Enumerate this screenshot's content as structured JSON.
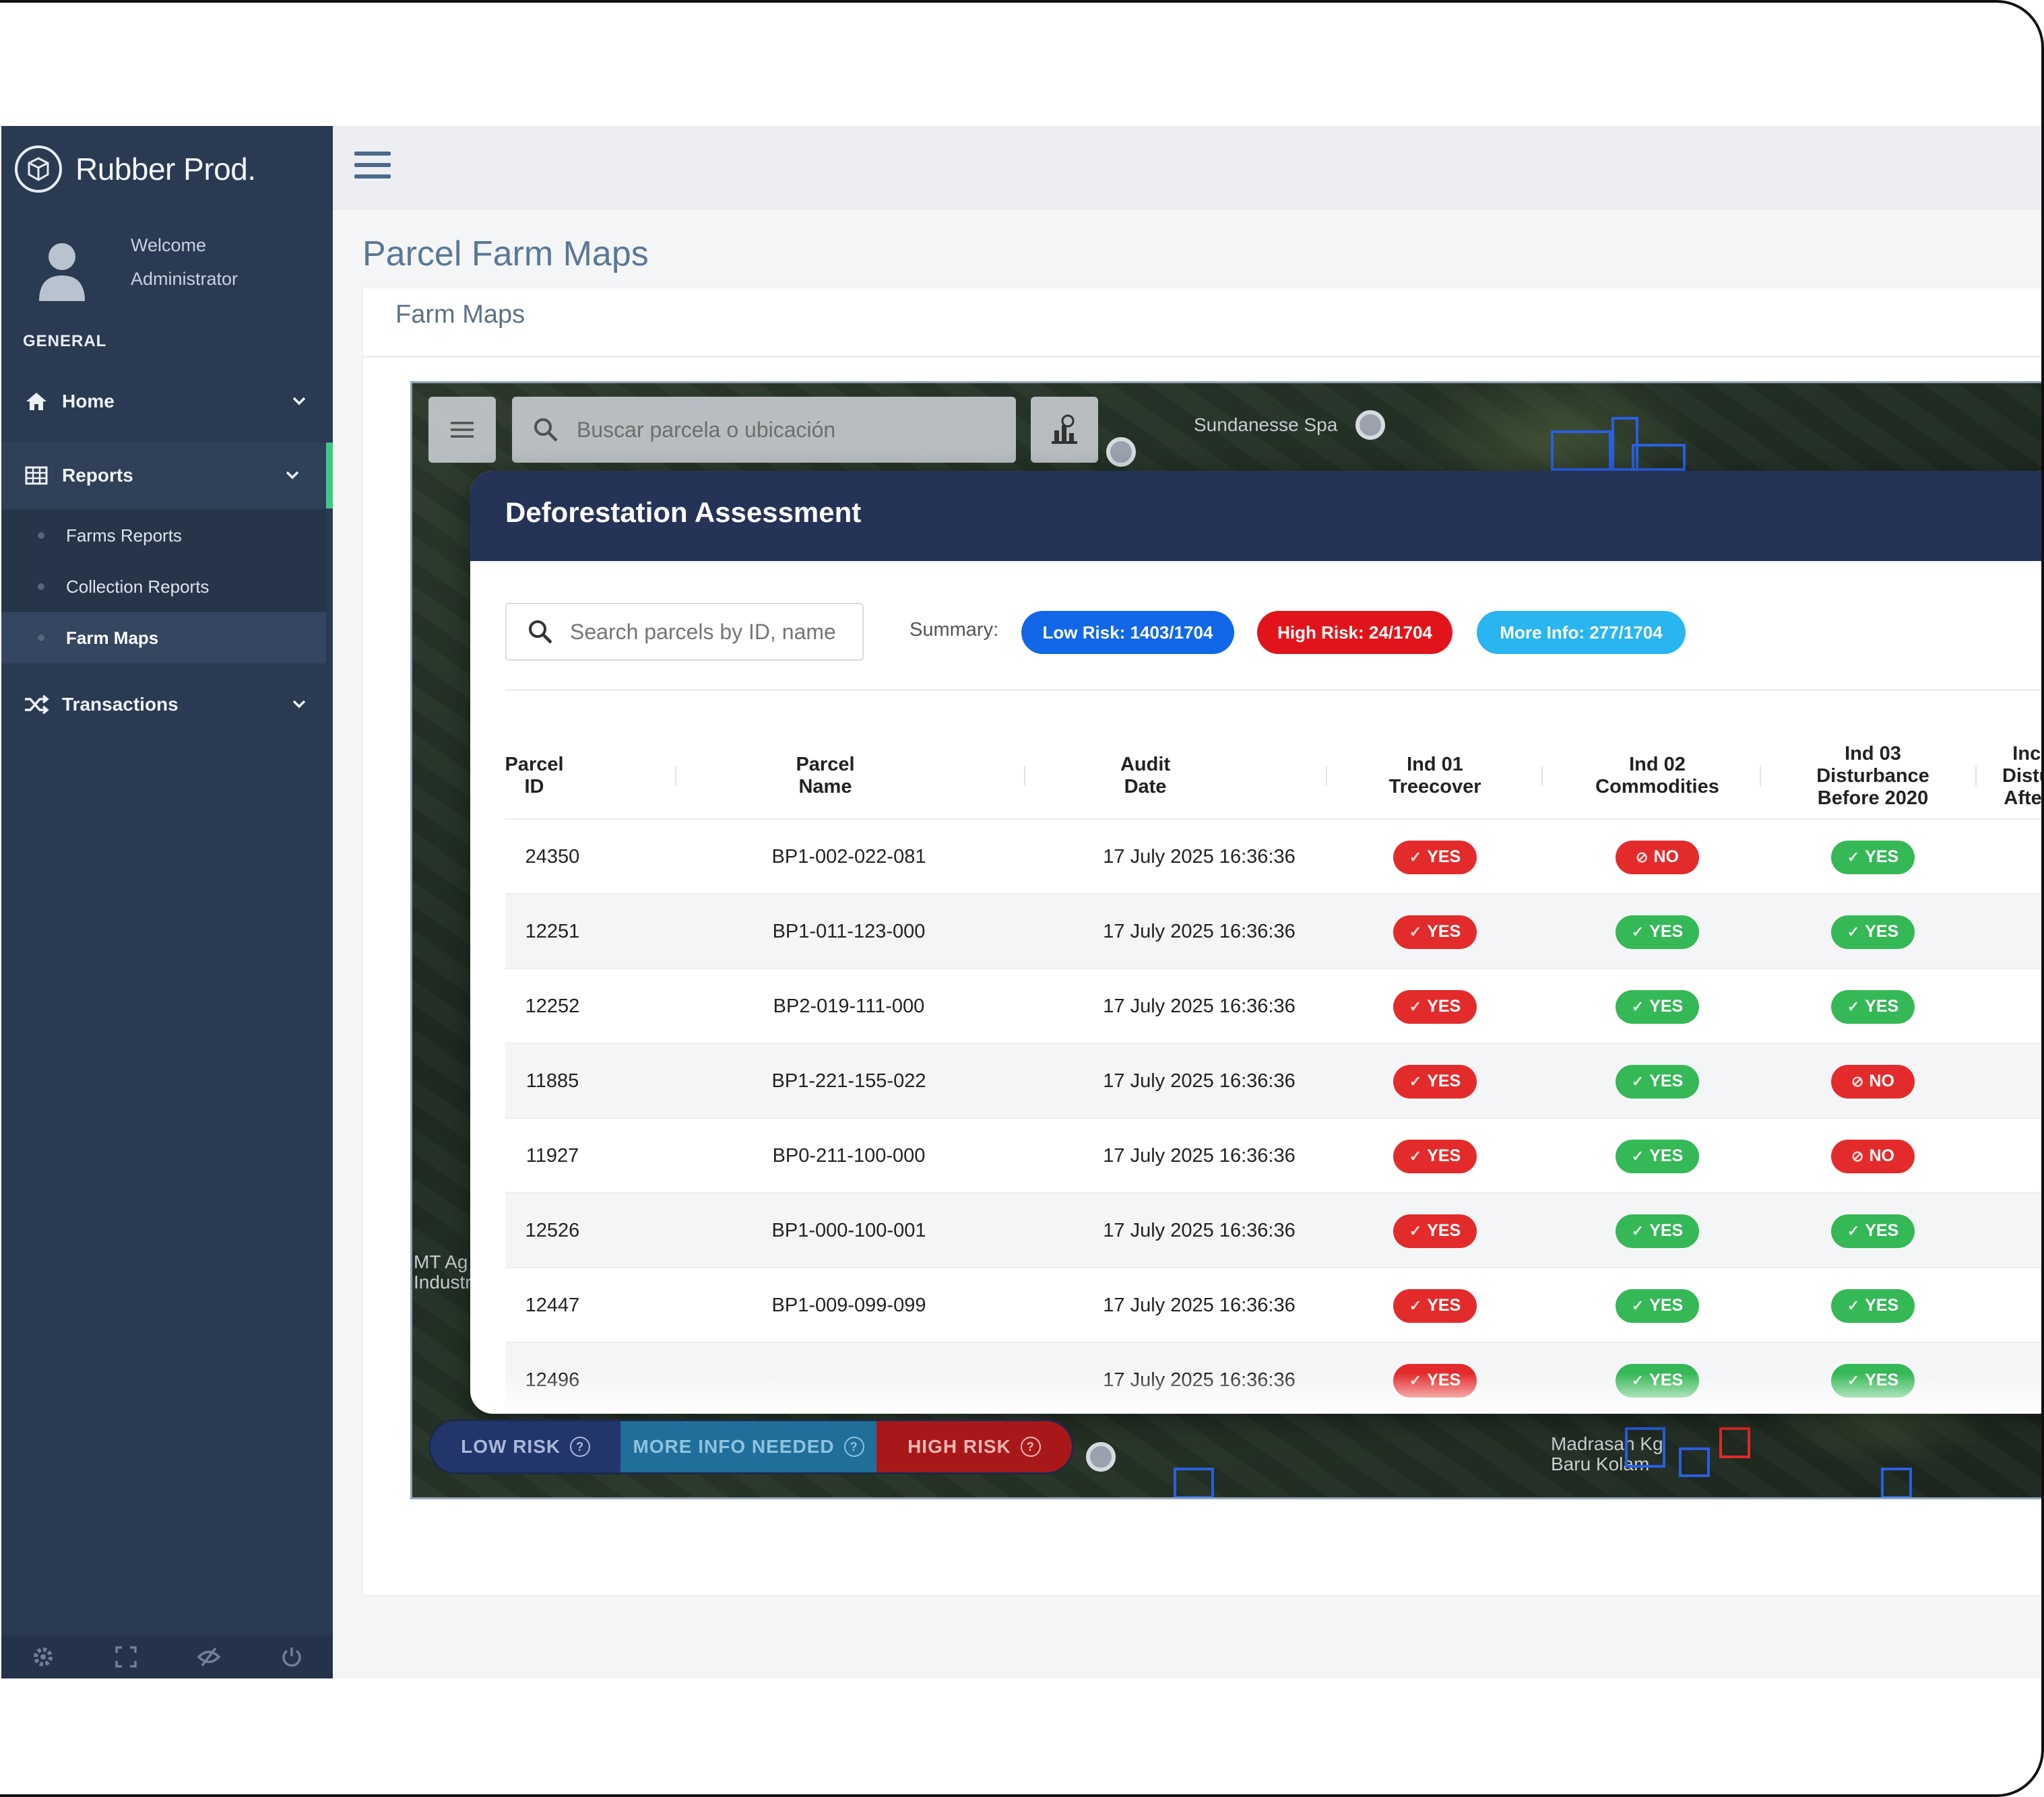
{
  "app": {
    "brand": "Rubber Prod."
  },
  "user": {
    "welcome": "Welcome",
    "name": "Administrator"
  },
  "sidebar": {
    "section": "GENERAL",
    "items": [
      {
        "label": "Home",
        "icon": "home-icon"
      },
      {
        "label": "Reports",
        "icon": "table-icon"
      },
      {
        "label": "Transactions",
        "icon": "shuffle-icon"
      }
    ],
    "sub_items": [
      {
        "label": "Farms Reports"
      },
      {
        "label": "Collection Reports"
      },
      {
        "label": "Farm Maps"
      }
    ],
    "footer_icons": [
      "gear-icon",
      "fullscreen-icon",
      "eye-off-icon",
      "power-icon"
    ]
  },
  "page": {
    "title": "Parcel Farm Maps",
    "card_title": "Farm Maps"
  },
  "map": {
    "search_placeholder": "Buscar parcela o ubicación",
    "poi": [
      {
        "label": "Sundanesse Spa"
      },
      {
        "label": "MT Ag\nIndustri"
      },
      {
        "label": "Madrasah Kg\nBaru Kolam"
      }
    ]
  },
  "modal": {
    "title": "Deforestation Assessment",
    "search_placeholder": "Search parcels by ID, name",
    "summary_label": "Summary:",
    "pills": {
      "low": "Low Risk: 1403/1704",
      "high": "High Risk: 24/1704",
      "info": "More Info: 277/1704"
    },
    "columns": [
      "Parcel\nID",
      "Parcel\nName",
      "Audit\nDate",
      "Ind 01\nTreecover",
      "Ind 02\nCommodities",
      "Ind 03\nDisturbance\nBefore 2020",
      "Inc\nDistu\nAfter"
    ],
    "rows": [
      {
        "id": "24350",
        "name": "BP1-002-022-081",
        "date": "17 July 2025 16:36:36",
        "ind01": "YES",
        "ind02": "NO",
        "ind03": "YES"
      },
      {
        "id": "12251",
        "name": "BP1-011-123-000",
        "date": "17 July 2025 16:36:36",
        "ind01": "YES",
        "ind02": "YES",
        "ind03": "YES"
      },
      {
        "id": "12252",
        "name": "BP2-019-111-000",
        "date": "17 July 2025 16:36:36",
        "ind01": "YES",
        "ind02": "YES",
        "ind03": "YES"
      },
      {
        "id": "11885",
        "name": "BP1-221-155-022",
        "date": "17 July 2025 16:36:36",
        "ind01": "YES",
        "ind02": "YES",
        "ind03": "NO"
      },
      {
        "id": "11927",
        "name": "BP0-211-100-000",
        "date": "17 July 2025 16:36:36",
        "ind01": "YES",
        "ind02": "YES",
        "ind03": "NO"
      },
      {
        "id": "12526",
        "name": "BP1-000-100-001",
        "date": "17 July 2025 16:36:36",
        "ind01": "YES",
        "ind02": "YES",
        "ind03": "YES"
      },
      {
        "id": "12447",
        "name": "BP1-009-099-099",
        "date": "17 July 2025 16:36:36",
        "ind01": "YES",
        "ind02": "YES",
        "ind03": "YES"
      },
      {
        "id": "12496",
        "name": "",
        "date": "17 July 2025 16:36:36",
        "ind01": "YES",
        "ind02": "YES",
        "ind03": "YES"
      }
    ]
  },
  "legend": {
    "low": "LOW RISK",
    "info": "MORE INFO NEEDED",
    "high": "HIGH RISK"
  },
  "colors": {
    "sidebar_bg": "#2a3a52",
    "accent": "#3ec98a",
    "modal_header": "#253356",
    "low_risk": "#1267e8",
    "high_risk": "#e2141b",
    "more_info": "#29b6f0",
    "yes_green": "#35b856"
  }
}
